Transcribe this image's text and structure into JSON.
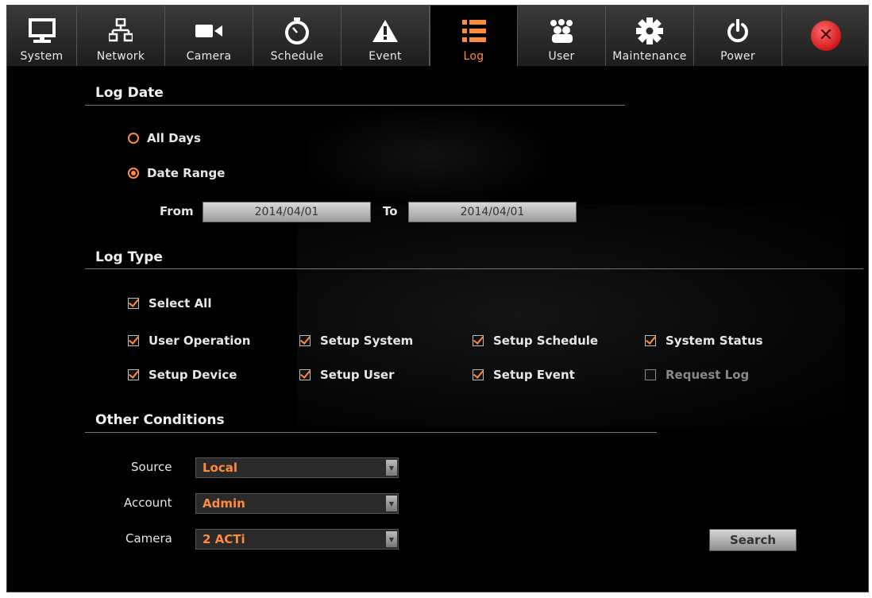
{
  "toolbar": {
    "tabs": [
      {
        "label": "System",
        "icon": "monitor-icon"
      },
      {
        "label": "Network",
        "icon": "network-icon"
      },
      {
        "label": "Camera",
        "icon": "camera-icon"
      },
      {
        "label": "Schedule",
        "icon": "clock-icon"
      },
      {
        "label": "Event",
        "icon": "warning-icon"
      },
      {
        "label": "Log",
        "icon": "list-icon",
        "active": true
      },
      {
        "label": "User",
        "icon": "users-icon"
      },
      {
        "label": "Maintenance",
        "icon": "gear-icon"
      },
      {
        "label": "Power",
        "icon": "power-icon"
      }
    ],
    "close_glyph": "✕"
  },
  "log_date": {
    "title": "Log Date",
    "all_days": "All Days",
    "date_range": "Date Range",
    "selected": "date_range",
    "from_label": "From",
    "from_value": "2014/04/01",
    "to_label": "To",
    "to_value": "2014/04/01"
  },
  "log_type": {
    "title": "Log Type",
    "select_all": {
      "label": "Select All",
      "checked": true
    },
    "items": [
      {
        "label": "User Operation",
        "checked": true
      },
      {
        "label": "Setup System",
        "checked": true
      },
      {
        "label": "Setup Schedule",
        "checked": true
      },
      {
        "label": "System Status",
        "checked": true
      },
      {
        "label": "Setup Device",
        "checked": true
      },
      {
        "label": "Setup User",
        "checked": true
      },
      {
        "label": "Setup Event",
        "checked": true
      },
      {
        "label": "Request Log",
        "checked": false
      }
    ]
  },
  "other": {
    "title": "Other Conditions",
    "source_label": "Source",
    "source_value": "Local",
    "account_label": "Account",
    "account_value": "Admin",
    "camera_label": "Camera",
    "camera_value": "2 ACTi"
  },
  "search_label": "Search",
  "colors": {
    "accent": "#ff8a3c",
    "background": "#000000"
  }
}
